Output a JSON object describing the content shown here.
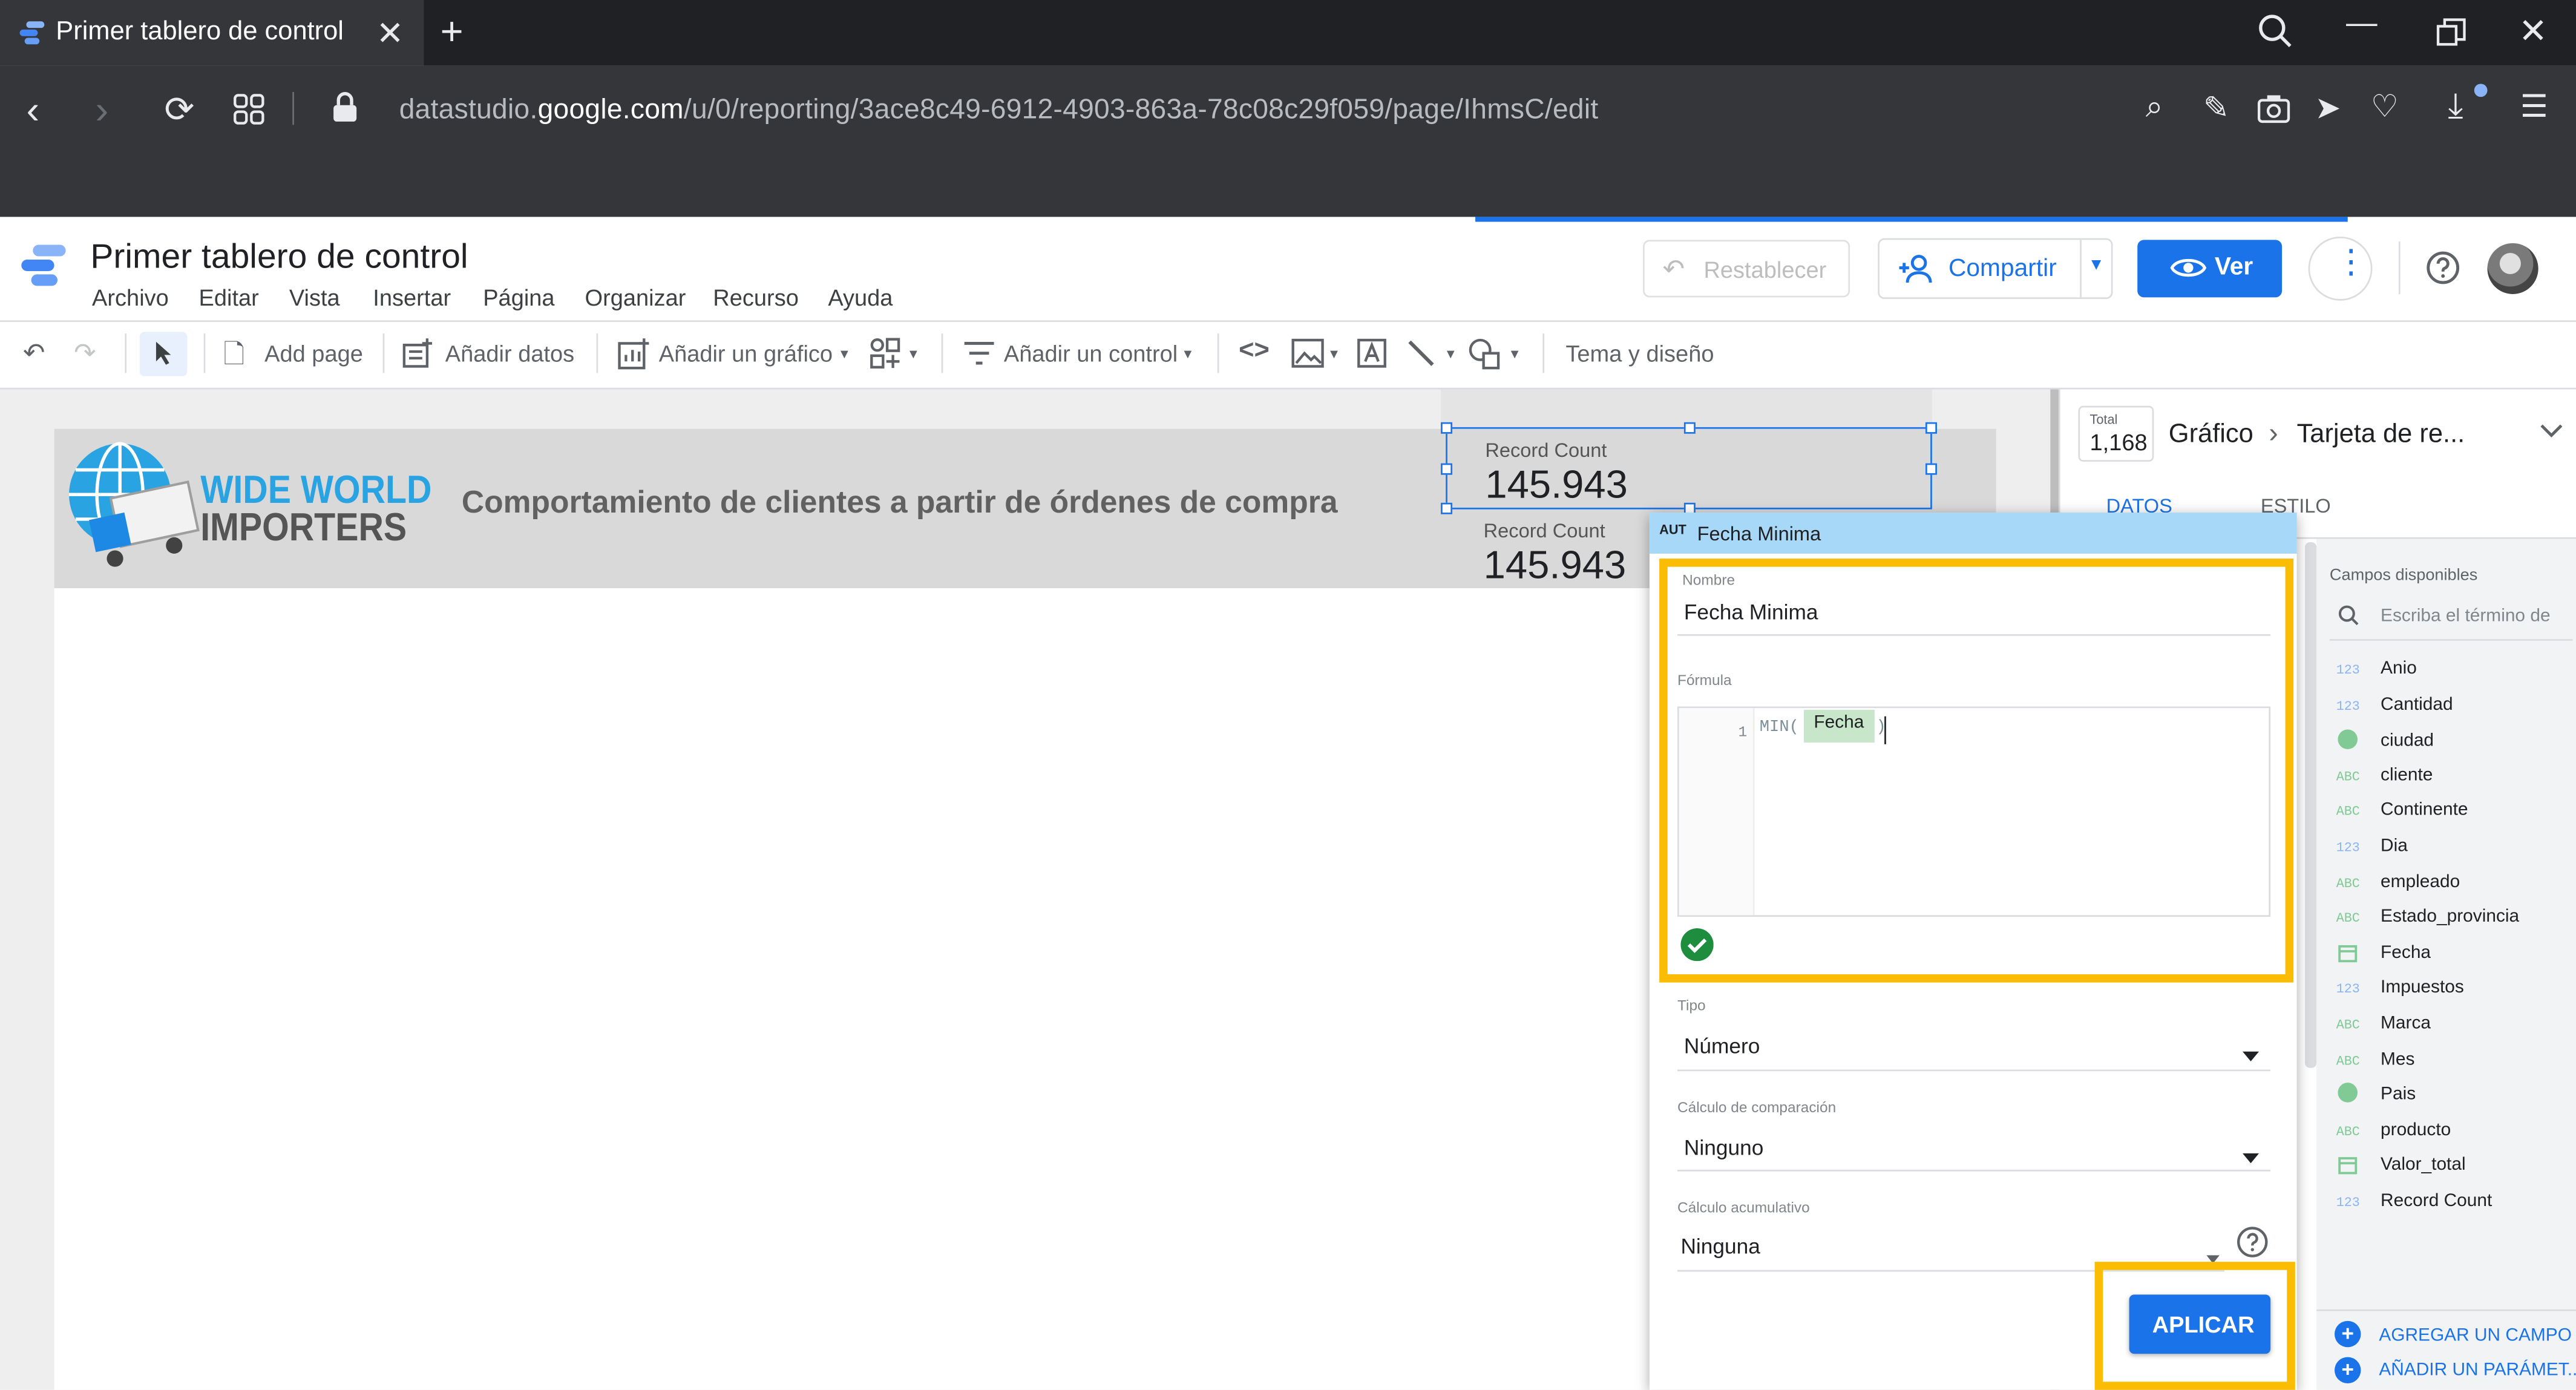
{
  "browser": {
    "tab_title": "Primer tablero de control",
    "url_prefix": "datastudio.",
    "url_domain": "google.com",
    "url_path": "/u/0/reporting/3ace8c49-6912-4903-863a-78c08c29f059/page/IhmsC/edit"
  },
  "app": {
    "doc_title": "Primer tablero de control",
    "menu": [
      "Archivo",
      "Editar",
      "Vista",
      "Insertar",
      "Página",
      "Organizar",
      "Recurso",
      "Ayuda"
    ],
    "reset_label": "Restablecer",
    "share_label": "Compartir",
    "view_label": "Ver"
  },
  "toolbar": {
    "add_page": "Add page",
    "add_data": "Añadir datos",
    "add_chart": "Añadir un gráfico",
    "add_control": "Añadir un control",
    "theme": "Tema y diseño"
  },
  "report": {
    "logo_line1": "WIDE WORLD",
    "logo_line2": "IMPORTERS",
    "title": "Comportamiento de clientes a partir de órdenes de compra",
    "scorecards": [
      {
        "label": "Record Count",
        "value": "145.943"
      },
      {
        "label": "Record Count",
        "value": "145.943"
      }
    ]
  },
  "panel": {
    "total_label": "Total",
    "total_value": "1,168",
    "breadcrumb_1": "Gráfico",
    "breadcrumb_2": "Tarjeta de re...",
    "tab_data": "DATOS",
    "tab_style": "ESTILO",
    "available_fields_title": "Campos disponibles",
    "search_placeholder": "Escriba el término de",
    "fields": [
      {
        "type": "123",
        "name": "Anio"
      },
      {
        "type": "123",
        "name": "Cantidad"
      },
      {
        "type": "geo",
        "name": "ciudad"
      },
      {
        "type": "ABC",
        "name": "cliente"
      },
      {
        "type": "ABC",
        "name": "Continente"
      },
      {
        "type": "123",
        "name": "Dia"
      },
      {
        "type": "ABC",
        "name": "empleado"
      },
      {
        "type": "ABC",
        "name": "Estado_provincia"
      },
      {
        "type": "date",
        "name": "Fecha"
      },
      {
        "type": "123",
        "name": "Impuestos"
      },
      {
        "type": "ABC",
        "name": "Marca"
      },
      {
        "type": "ABC",
        "name": "Mes"
      },
      {
        "type": "geo",
        "name": "Pais"
      },
      {
        "type": "ABC",
        "name": "producto"
      },
      {
        "type": "date",
        "name": "Valor_total"
      },
      {
        "type": "123",
        "name": "Record Count"
      }
    ],
    "add_field": "AGREGAR UN CAMPO",
    "add_param": "AÑADIR UN PARÁMET..."
  },
  "dialog": {
    "badge": "AUT",
    "header_title": "Fecha Minima",
    "name_label": "Nombre",
    "name_value": "Fecha Minima",
    "formula_label": "Fórmula",
    "line_number": "1",
    "formula_fn": "MIN(",
    "formula_field": "Fecha",
    "formula_close": ")",
    "type_label": "Tipo",
    "type_value": "Número",
    "comparison_label": "Cálculo de comparación",
    "comparison_value": "Ninguno",
    "cumulative_label": "Cálculo acumulativo",
    "cumulative_value": "Ninguna",
    "apply_label": "APLICAR"
  },
  "colors": {
    "accent": "#1a73e8",
    "highlight": "#fbbc04",
    "valid": "#1e8e3e",
    "chrome_dark": "#202124",
    "chrome_mid": "#35363a"
  }
}
